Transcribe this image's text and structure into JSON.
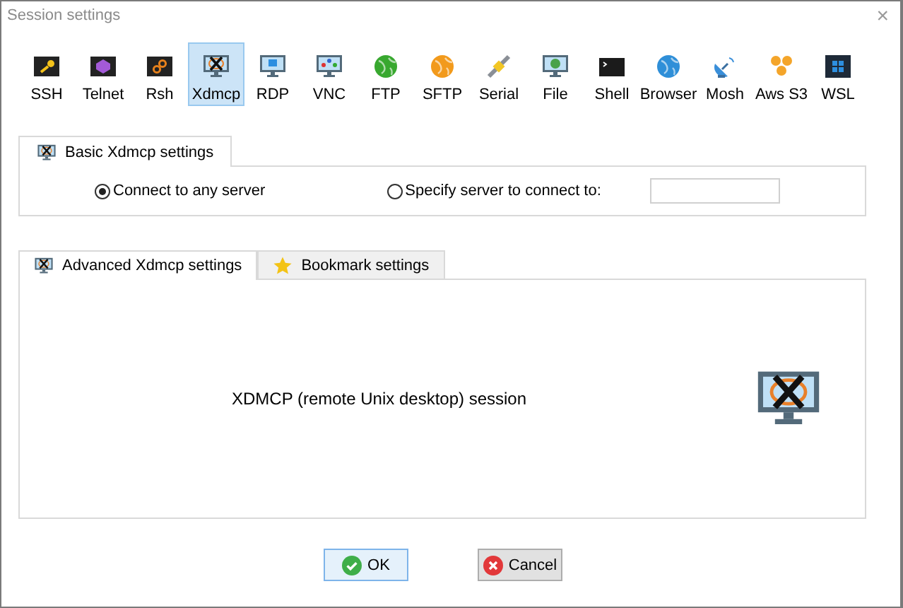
{
  "window": {
    "title": "Session settings",
    "close": "×"
  },
  "protocols": [
    {
      "label": "SSH",
      "selected": false
    },
    {
      "label": "Telnet",
      "selected": false
    },
    {
      "label": "Rsh",
      "selected": false
    },
    {
      "label": "Xdmcp",
      "selected": true
    },
    {
      "label": "RDP",
      "selected": false
    },
    {
      "label": "VNC",
      "selected": false
    },
    {
      "label": "FTP",
      "selected": false
    },
    {
      "label": "SFTP",
      "selected": false
    },
    {
      "label": "Serial",
      "selected": false
    },
    {
      "label": "File",
      "selected": false
    },
    {
      "label": "Shell",
      "selected": false
    },
    {
      "label": "Browser",
      "selected": false
    },
    {
      "label": "Mosh",
      "selected": false
    },
    {
      "label": "Aws S3",
      "selected": false
    },
    {
      "label": "WSL",
      "selected": false
    }
  ],
  "basic_tab": {
    "label": "Basic Xdmcp settings",
    "selected": true
  },
  "radios": [
    {
      "label": "Connect to any server",
      "selected": true
    },
    {
      "label": "Specify server to connect to:",
      "selected": false
    }
  ],
  "lower_tabs": [
    {
      "label": "Advanced Xdmcp settings",
      "kind": "xdmcp",
      "selected": true
    },
    {
      "label": "Bookmark settings",
      "kind": "star",
      "selected": false
    }
  ],
  "description": "XDMCP (remote Unix desktop) session",
  "buttons": [
    {
      "label": "OK",
      "kind": "ok"
    },
    {
      "label": "Cancel",
      "kind": "cancel"
    }
  ]
}
